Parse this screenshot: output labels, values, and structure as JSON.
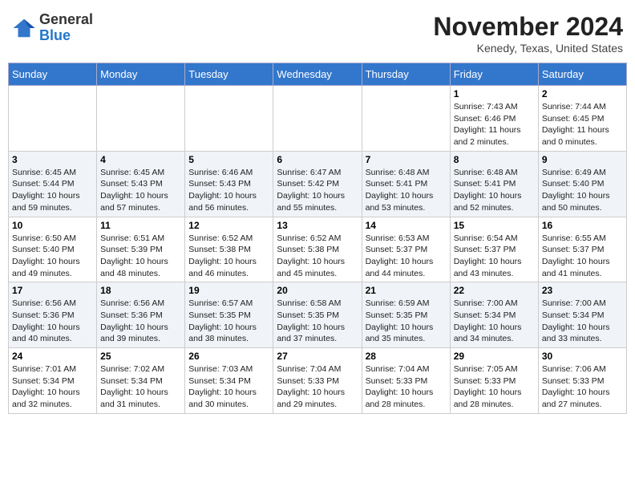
{
  "header": {
    "logo_general": "General",
    "logo_blue": "Blue",
    "month_year": "November 2024",
    "location": "Kenedy, Texas, United States"
  },
  "weekdays": [
    "Sunday",
    "Monday",
    "Tuesday",
    "Wednesday",
    "Thursday",
    "Friday",
    "Saturday"
  ],
  "weeks": [
    [
      {
        "day": "",
        "sunrise": "",
        "sunset": "",
        "daylight": ""
      },
      {
        "day": "",
        "sunrise": "",
        "sunset": "",
        "daylight": ""
      },
      {
        "day": "",
        "sunrise": "",
        "sunset": "",
        "daylight": ""
      },
      {
        "day": "",
        "sunrise": "",
        "sunset": "",
        "daylight": ""
      },
      {
        "day": "",
        "sunrise": "",
        "sunset": "",
        "daylight": ""
      },
      {
        "day": "1",
        "sunrise": "Sunrise: 7:43 AM",
        "sunset": "Sunset: 6:46 PM",
        "daylight": "Daylight: 11 hours and 2 minutes."
      },
      {
        "day": "2",
        "sunrise": "Sunrise: 7:44 AM",
        "sunset": "Sunset: 6:45 PM",
        "daylight": "Daylight: 11 hours and 0 minutes."
      }
    ],
    [
      {
        "day": "3",
        "sunrise": "Sunrise: 6:45 AM",
        "sunset": "Sunset: 5:44 PM",
        "daylight": "Daylight: 10 hours and 59 minutes."
      },
      {
        "day": "4",
        "sunrise": "Sunrise: 6:45 AM",
        "sunset": "Sunset: 5:43 PM",
        "daylight": "Daylight: 10 hours and 57 minutes."
      },
      {
        "day": "5",
        "sunrise": "Sunrise: 6:46 AM",
        "sunset": "Sunset: 5:43 PM",
        "daylight": "Daylight: 10 hours and 56 minutes."
      },
      {
        "day": "6",
        "sunrise": "Sunrise: 6:47 AM",
        "sunset": "Sunset: 5:42 PM",
        "daylight": "Daylight: 10 hours and 55 minutes."
      },
      {
        "day": "7",
        "sunrise": "Sunrise: 6:48 AM",
        "sunset": "Sunset: 5:41 PM",
        "daylight": "Daylight: 10 hours and 53 minutes."
      },
      {
        "day": "8",
        "sunrise": "Sunrise: 6:48 AM",
        "sunset": "Sunset: 5:41 PM",
        "daylight": "Daylight: 10 hours and 52 minutes."
      },
      {
        "day": "9",
        "sunrise": "Sunrise: 6:49 AM",
        "sunset": "Sunset: 5:40 PM",
        "daylight": "Daylight: 10 hours and 50 minutes."
      }
    ],
    [
      {
        "day": "10",
        "sunrise": "Sunrise: 6:50 AM",
        "sunset": "Sunset: 5:40 PM",
        "daylight": "Daylight: 10 hours and 49 minutes."
      },
      {
        "day": "11",
        "sunrise": "Sunrise: 6:51 AM",
        "sunset": "Sunset: 5:39 PM",
        "daylight": "Daylight: 10 hours and 48 minutes."
      },
      {
        "day": "12",
        "sunrise": "Sunrise: 6:52 AM",
        "sunset": "Sunset: 5:38 PM",
        "daylight": "Daylight: 10 hours and 46 minutes."
      },
      {
        "day": "13",
        "sunrise": "Sunrise: 6:52 AM",
        "sunset": "Sunset: 5:38 PM",
        "daylight": "Daylight: 10 hours and 45 minutes."
      },
      {
        "day": "14",
        "sunrise": "Sunrise: 6:53 AM",
        "sunset": "Sunset: 5:37 PM",
        "daylight": "Daylight: 10 hours and 44 minutes."
      },
      {
        "day": "15",
        "sunrise": "Sunrise: 6:54 AM",
        "sunset": "Sunset: 5:37 PM",
        "daylight": "Daylight: 10 hours and 43 minutes."
      },
      {
        "day": "16",
        "sunrise": "Sunrise: 6:55 AM",
        "sunset": "Sunset: 5:37 PM",
        "daylight": "Daylight: 10 hours and 41 minutes."
      }
    ],
    [
      {
        "day": "17",
        "sunrise": "Sunrise: 6:56 AM",
        "sunset": "Sunset: 5:36 PM",
        "daylight": "Daylight: 10 hours and 40 minutes."
      },
      {
        "day": "18",
        "sunrise": "Sunrise: 6:56 AM",
        "sunset": "Sunset: 5:36 PM",
        "daylight": "Daylight: 10 hours and 39 minutes."
      },
      {
        "day": "19",
        "sunrise": "Sunrise: 6:57 AM",
        "sunset": "Sunset: 5:35 PM",
        "daylight": "Daylight: 10 hours and 38 minutes."
      },
      {
        "day": "20",
        "sunrise": "Sunrise: 6:58 AM",
        "sunset": "Sunset: 5:35 PM",
        "daylight": "Daylight: 10 hours and 37 minutes."
      },
      {
        "day": "21",
        "sunrise": "Sunrise: 6:59 AM",
        "sunset": "Sunset: 5:35 PM",
        "daylight": "Daylight: 10 hours and 35 minutes."
      },
      {
        "day": "22",
        "sunrise": "Sunrise: 7:00 AM",
        "sunset": "Sunset: 5:34 PM",
        "daylight": "Daylight: 10 hours and 34 minutes."
      },
      {
        "day": "23",
        "sunrise": "Sunrise: 7:00 AM",
        "sunset": "Sunset: 5:34 PM",
        "daylight": "Daylight: 10 hours and 33 minutes."
      }
    ],
    [
      {
        "day": "24",
        "sunrise": "Sunrise: 7:01 AM",
        "sunset": "Sunset: 5:34 PM",
        "daylight": "Daylight: 10 hours and 32 minutes."
      },
      {
        "day": "25",
        "sunrise": "Sunrise: 7:02 AM",
        "sunset": "Sunset: 5:34 PM",
        "daylight": "Daylight: 10 hours and 31 minutes."
      },
      {
        "day": "26",
        "sunrise": "Sunrise: 7:03 AM",
        "sunset": "Sunset: 5:34 PM",
        "daylight": "Daylight: 10 hours and 30 minutes."
      },
      {
        "day": "27",
        "sunrise": "Sunrise: 7:04 AM",
        "sunset": "Sunset: 5:33 PM",
        "daylight": "Daylight: 10 hours and 29 minutes."
      },
      {
        "day": "28",
        "sunrise": "Sunrise: 7:04 AM",
        "sunset": "Sunset: 5:33 PM",
        "daylight": "Daylight: 10 hours and 28 minutes."
      },
      {
        "day": "29",
        "sunrise": "Sunrise: 7:05 AM",
        "sunset": "Sunset: 5:33 PM",
        "daylight": "Daylight: 10 hours and 28 minutes."
      },
      {
        "day": "30",
        "sunrise": "Sunrise: 7:06 AM",
        "sunset": "Sunset: 5:33 PM",
        "daylight": "Daylight: 10 hours and 27 minutes."
      }
    ]
  ]
}
